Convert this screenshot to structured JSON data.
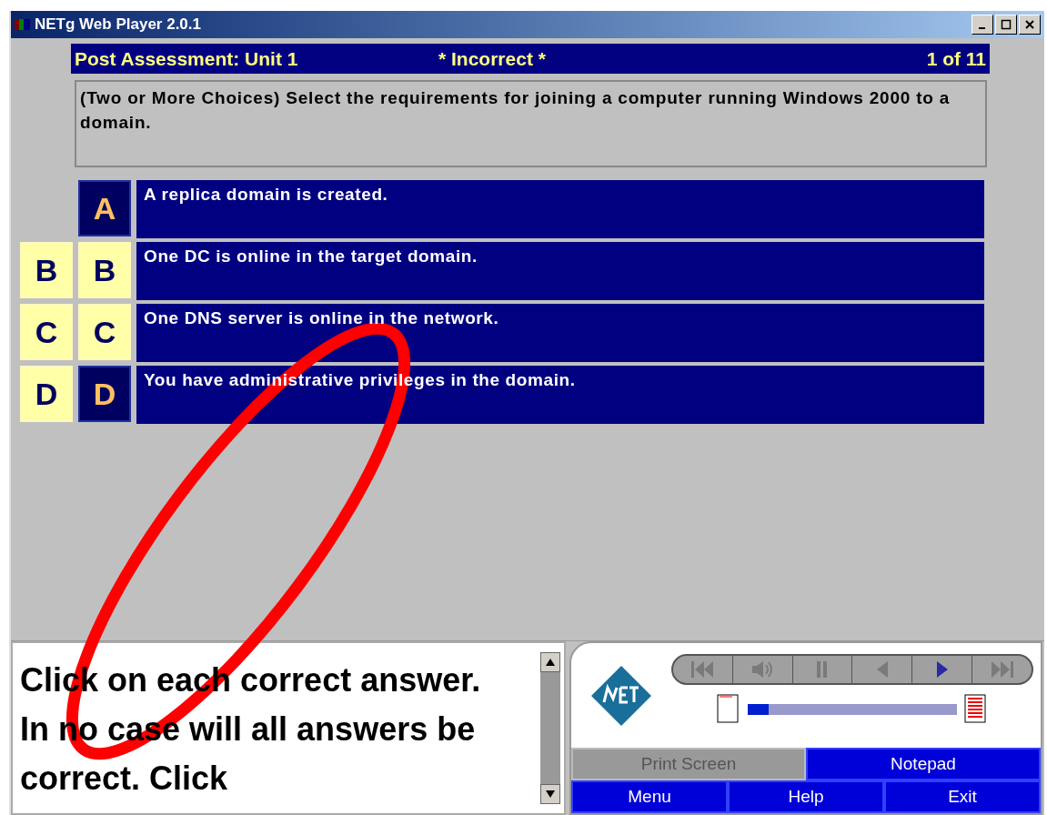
{
  "window": {
    "title": "NETg Web Player 2.0.1"
  },
  "header": {
    "title": "Post Assessment: Unit 1",
    "result": "* Incorrect *",
    "counter": "1 of 11"
  },
  "question": "(Two or More Choices) Select the requirements for joining a computer running Windows 2000 to a domain.",
  "options": [
    {
      "letter": "A",
      "text": "A replica domain is created.",
      "correct": false,
      "selected": false
    },
    {
      "letter": "B",
      "key_letter": "B",
      "text": "One DC is online in the target domain.",
      "correct": true,
      "selected": true
    },
    {
      "letter": "C",
      "key_letter": "C",
      "text": "One DNS server is online in the network.",
      "correct": true,
      "selected": true
    },
    {
      "letter": "D",
      "key_letter": "D",
      "text": "You have administrative privileges in the domain.",
      "correct": true,
      "selected": false
    }
  ],
  "instructions": "Click on each correct answer. In no case will all answers be correct. Click",
  "progress": {
    "level": 0.1
  },
  "buttons": [
    {
      "label": "Print Screen",
      "disabled": true
    },
    {
      "label": "Notepad",
      "disabled": false
    }
  ],
  "nav_buttons": [
    {
      "label": "Menu"
    },
    {
      "label": "Help"
    },
    {
      "label": "Exit"
    }
  ]
}
